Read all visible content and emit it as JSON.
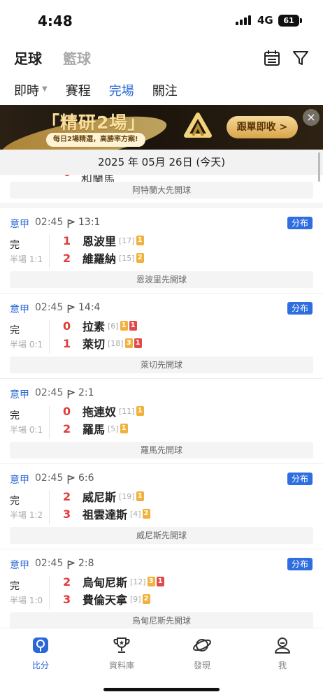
{
  "status": {
    "time": "4:48",
    "network": "4G",
    "battery": "61"
  },
  "header": {
    "sport_tabs": [
      "足球",
      "籃球"
    ],
    "filter_tabs": [
      "即時",
      "賽程",
      "完場",
      "關注"
    ],
    "calendar_icon": "calendar-icon",
    "filter_icon": "filter-icon"
  },
  "banner": {
    "title": "「精研2場」",
    "subtitle": "每日2場精選，高勝率方案!",
    "cta": "跟單即收 >",
    "close": "×"
  },
  "date_label": "2025 年 05月 26日 (今天)",
  "prev_match": {
    "partial_name": "和蘭馬",
    "kickoff": "阿特蘭大先開球"
  },
  "matches": [
    {
      "league": "意甲",
      "time": "02:45",
      "corners": "13:1",
      "dist": "分布",
      "status": "完",
      "half": "半場 1:1",
      "home": {
        "score": "1",
        "name": "恩波里",
        "rank": "[17]",
        "cards": [
          {
            "t": "y",
            "n": "1"
          }
        ]
      },
      "away": {
        "score": "2",
        "name": "維羅納",
        "rank": "[15]",
        "cards": [
          {
            "t": "y",
            "n": "2"
          }
        ]
      },
      "kickoff": "恩波里先開球"
    },
    {
      "league": "意甲",
      "time": "02:45",
      "corners": "14:4",
      "dist": "分布",
      "status": "完",
      "half": "半場 0:1",
      "home": {
        "score": "0",
        "name": "拉素",
        "rank": "[6]",
        "cards": [
          {
            "t": "y",
            "n": "1"
          },
          {
            "t": "r",
            "n": "1"
          }
        ]
      },
      "away": {
        "score": "1",
        "name": "萊切",
        "rank": "[18]",
        "cards": [
          {
            "t": "y",
            "n": "3"
          },
          {
            "t": "r",
            "n": "1"
          }
        ]
      },
      "kickoff": "萊切先開球"
    },
    {
      "league": "意甲",
      "time": "02:45",
      "corners": "2:1",
      "dist": "",
      "status": "完",
      "half": "半場 0:1",
      "home": {
        "score": "0",
        "name": "拖連奴",
        "rank": "[11]",
        "cards": [
          {
            "t": "y",
            "n": "1"
          }
        ]
      },
      "away": {
        "score": "2",
        "name": "羅馬",
        "rank": "[5]",
        "cards": [
          {
            "t": "y",
            "n": "1"
          }
        ]
      },
      "kickoff": "羅馬先開球"
    },
    {
      "league": "意甲",
      "time": "02:45",
      "corners": "6:6",
      "dist": "分布",
      "status": "完",
      "half": "半場 1:2",
      "home": {
        "score": "2",
        "name": "威尼斯",
        "rank": "[19]",
        "cards": [
          {
            "t": "y",
            "n": "1"
          }
        ]
      },
      "away": {
        "score": "3",
        "name": "祖雲達斯",
        "rank": "[4]",
        "cards": [
          {
            "t": "y",
            "n": "2"
          }
        ]
      },
      "kickoff": "威尼斯先開球"
    },
    {
      "league": "意甲",
      "time": "02:45",
      "corners": "2:8",
      "dist": "分布",
      "status": "完",
      "half": "半場 1:0",
      "home": {
        "score": "2",
        "name": "烏甸尼斯",
        "rank": "[12]",
        "cards": [
          {
            "t": "y",
            "n": "3"
          },
          {
            "t": "r",
            "n": "1"
          }
        ]
      },
      "away": {
        "score": "3",
        "name": "費倫天拿",
        "rank": "[9]",
        "cards": [
          {
            "t": "y",
            "n": "2"
          }
        ]
      },
      "kickoff": "烏甸尼斯先開球"
    }
  ],
  "nav": [
    {
      "label": "比分",
      "icon": "score-icon",
      "active": true
    },
    {
      "label": "資料庫",
      "icon": "trophy-icon",
      "active": false
    },
    {
      "label": "發現",
      "icon": "planet-icon",
      "active": false
    },
    {
      "label": "我",
      "icon": "profile-icon",
      "active": false
    }
  ],
  "colors": {
    "accent": "#2a68d6",
    "score_red": "#e23b3b",
    "yellow_card": "#f1b13a",
    "red_card": "#e24a4a"
  }
}
